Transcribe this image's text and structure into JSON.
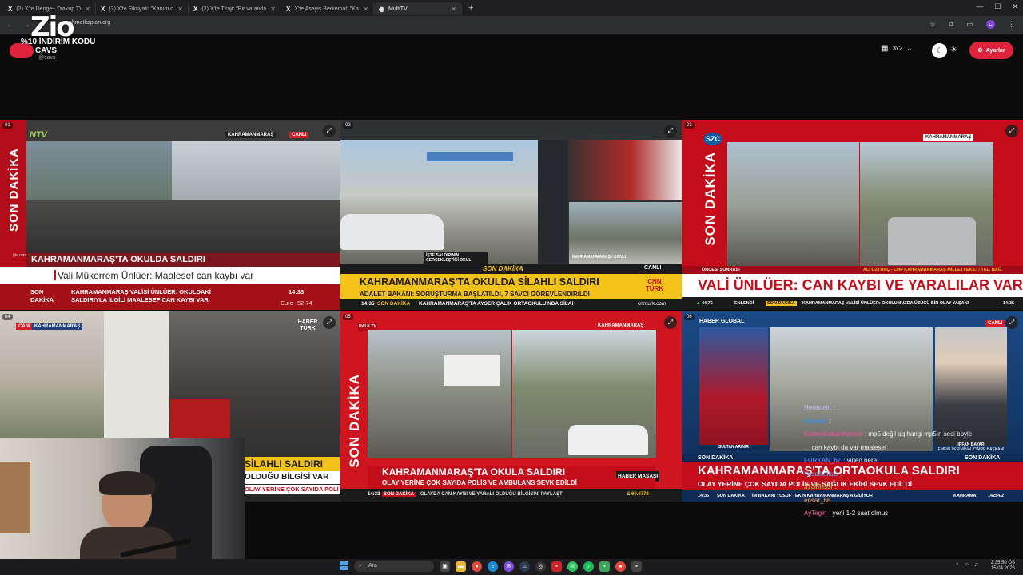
{
  "browser": {
    "tabs": [
      {
        "label": "(2) X'te Denge+ \"Yakup TV'nin"
      },
      {
        "label": "(2) X'te Fikriyati: \"Kanım donduı"
      },
      {
        "label": "(2) X'te Tiraji: \"Bir vatandaş, Har"
      },
      {
        "label": "X'te Asayiş Berkemal: \"Kahram"
      },
      {
        "label": "MultiTV"
      }
    ],
    "url": "ahmetkaplan.org"
  },
  "overlay": {
    "logo": "Zio",
    "promo": "%10 İNDİRİM KODU",
    "promo_code": "CAVS",
    "handle": "@cavs"
  },
  "toolbar": {
    "layout_label": "3x2",
    "settings_label": "Ayarlar"
  },
  "tiles": [
    {
      "num": "01",
      "channel": "NTV",
      "location": "KAHRAMANMARAŞ",
      "live": "CANLI",
      "side_text": "SON DAKİKA",
      "headline": "KAHRAMANMARAŞ'TA OKULDA SALDIRI",
      "subline": "Vali Mükerrem Ünlüer: Maalesef can kaybı var",
      "ticker_label": "SON DAKİKA",
      "ticker": "KAHRAMANMARAŞ VALİSİ ÜNLÜER: OKULDAKİ SALDIRIYLA İLGİLİ MAALESEF CAN KAYBI VAR",
      "time": "14:33",
      "euro_label": "Euro",
      "euro_value": "52.74",
      "web": "ntv.com.tr"
    },
    {
      "num": "02",
      "caption": "İŞTE SALDIRININ GERÇEKLEŞTİĞİ OKUL",
      "inset_caption": "KAHRAMANMARAŞ / CANLI",
      "breaking": "SON DAKİKA",
      "live": "CANLI",
      "channel": "CNN TÜRK",
      "headline": "KAHRAMANMARAŞ'TA OKULDA SİLAHLI SALDIRI",
      "subline": "ADALET BAKANI: SORUŞTURMA BAŞLATILDI, 7 SAVCI GÖREVLENDİRİLDİ",
      "time": "14:35",
      "ticker_label": "SON DAKİKA",
      "ticker": "KAHRAMANMARAŞ'TA AYSER ÇALIK ORTAOKULU'NDA SİLAH",
      "web": "cnnturk.com"
    },
    {
      "num": "03",
      "channel": "SZC",
      "location": "KAHRAMANMARAŞ",
      "side_text": "SON DAKİKA",
      "speaker": "ALİ ÖZTUNÇ - CHP KAHRAMANMARAŞ MİLLETVEKİLİ / TEL. BAĞ.",
      "prev_label": "ÖNCESİ SONRASI",
      "headline": "VALİ ÜNLÜER: CAN KAYBI VE YARALILAR VAR",
      "ticker_value": "44,76",
      "ticker_tag": "ENLENDİ",
      "ticker_label": "SON DAKİKA",
      "ticker": "KAHRAMANMARAŞ VALİSİ ÜNLÜER: OKULUMUZDA ÜZÜCÜ BİR OLAY YAŞANI",
      "time": "14:35"
    },
    {
      "num": "04",
      "location": "KAHRAMANMARAŞ",
      "live": "CANLI",
      "channel": "HABER TÜRK",
      "headline": "SİLAHLI SALDIRI",
      "subline": "OLDUĞU BİLGİSİ VAR",
      "ticker": "OLAY YERİNE ÇOK SAYIDA POLİ"
    },
    {
      "num": "05",
      "channel": "HALK TV",
      "location": "KAHRAMANMARAŞ",
      "side_text": "SON DAKİKA",
      "headline": "KAHRAMANMARAŞ'TA OKULA SALDIRI",
      "subline": "OLAY YERİNE ÇOK SAYIDA POLİS VE AMBULANS SEVK EDİLDİ",
      "desk": "HABER MASASI",
      "time": "14:33",
      "ticker_label": "SON DAKİKA",
      "ticker": "OLAYDA CAN KAYBI VE YARALI OLDUĞU BİLGİSİNİ PAYLAŞTI",
      "pound": "£ 60.6778"
    },
    {
      "num": "06",
      "channel": "HABER GLOBAL",
      "live": "CANLI",
      "anchor": "SULTAN ARINIR",
      "guest": "İRFAN BAYAR",
      "guest_title": "EMEKLİ KRİMİNAL DAİRE BAŞKANI",
      "breaking_left": "SON DAKİKA",
      "breaking_right": "SON DAKİKA",
      "headline": "KAHRAMANMARAŞ'TA ORTAOKULA SALDIRI",
      "subline": "OLAY YERİNE ÇOK SAYIDA POLİS VE SAĞLIK EKİBİ SEVK EDİLDİ",
      "time": "14:35",
      "ticker_label": "SON DAKİKA",
      "ticker": "İM BAKANI YUSUF TEKİN KAHRAMANMARAŞ'A GİDİYOR",
      "ticker_city": "KAHRAMA",
      "ticker_value": "14254.2"
    }
  ],
  "chat": [
    {
      "user": "Heraslein",
      "msg": ":",
      "color": "#c9b7ff"
    },
    {
      "user": "Stavita0",
      "msg": ":",
      "color": "#2b8cff"
    },
    {
      "user": "KartonKaikanKestrel",
      "msg": ": mp5 değil aq hangi mp5ın sesi boyle",
      "color": "#ff4fa0"
    },
    {
      "user": "...",
      "msg": "can kaybı da var maalesef",
      "color": "#6aa7ff"
    },
    {
      "user": "FURKAN_67",
      "msg": ": video nere",
      "color": "#7a8cff"
    },
    {
      "user": "Yusufkafkas",
      "msg": ":",
      "color": "#59c4ff"
    },
    {
      "user": "31ciMessi",
      "msg": ":",
      "color": "#8be05a"
    },
    {
      "user": "ensar_68",
      "msg": ":",
      "color": "#ff9a3c"
    },
    {
      "user": "AyTegin",
      "msg": ": yeni 1-2 saat olmus",
      "color": "#ff5f9f"
    }
  ],
  "taskbar": {
    "search_placeholder": "Ara",
    "time": "2:35:50 ÖS",
    "date": "15.04.2026"
  },
  "colors": {
    "accent": "#e0223a",
    "breaking_red": "#c4101c",
    "cnn_yellow": "#f2c21a"
  }
}
